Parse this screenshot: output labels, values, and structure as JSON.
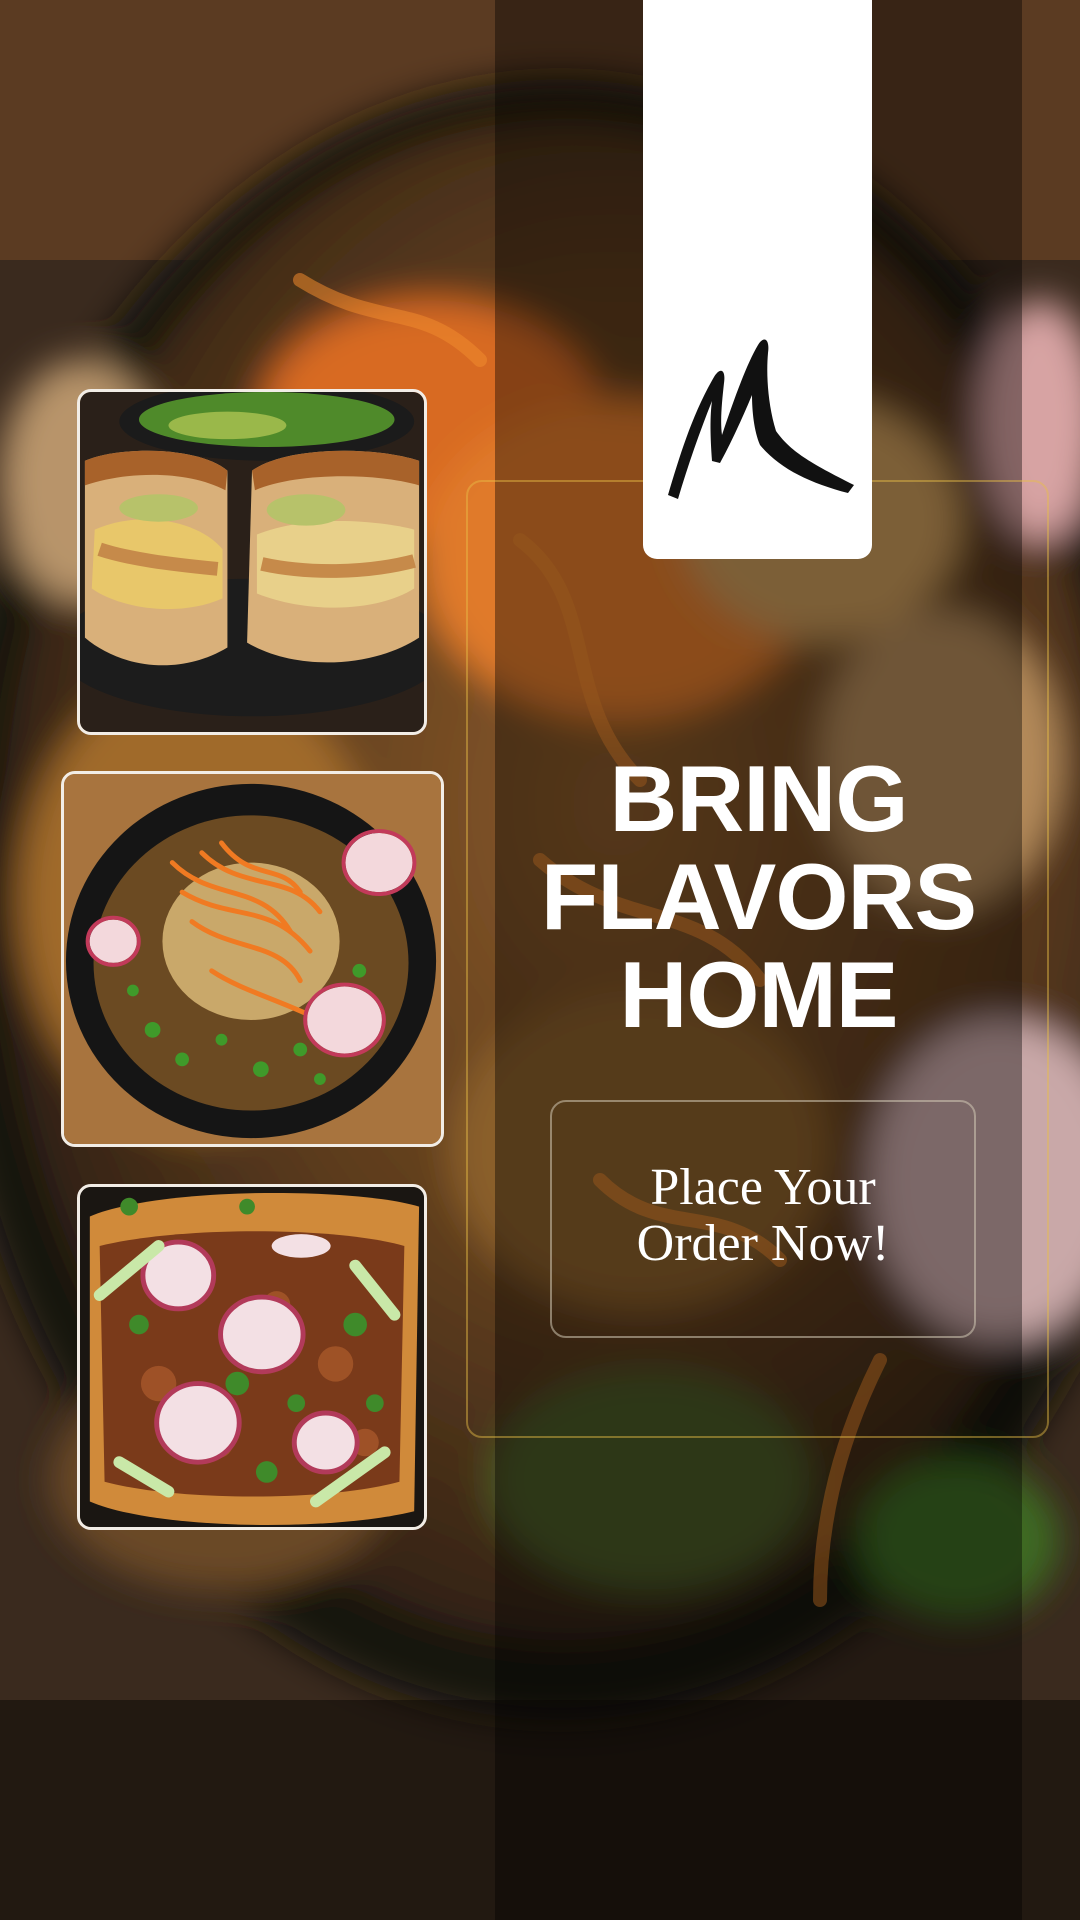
{
  "brand": {
    "logo_icon": "brush-stroke-m-logo-icon"
  },
  "headline": {
    "line1": "BRING",
    "line2": "FLAVORS",
    "line3": "HOME"
  },
  "cta": {
    "line1": "Place Your",
    "line2": "Order Now!"
  },
  "photos": [
    {
      "icon": "sandwich-photo"
    },
    {
      "icon": "noodle-bowl-photo"
    },
    {
      "icon": "radish-salad-photo"
    }
  ],
  "colors": {
    "frame_accent": "#e8be46",
    "text": "#ffffff",
    "logo_card": "#ffffff"
  }
}
